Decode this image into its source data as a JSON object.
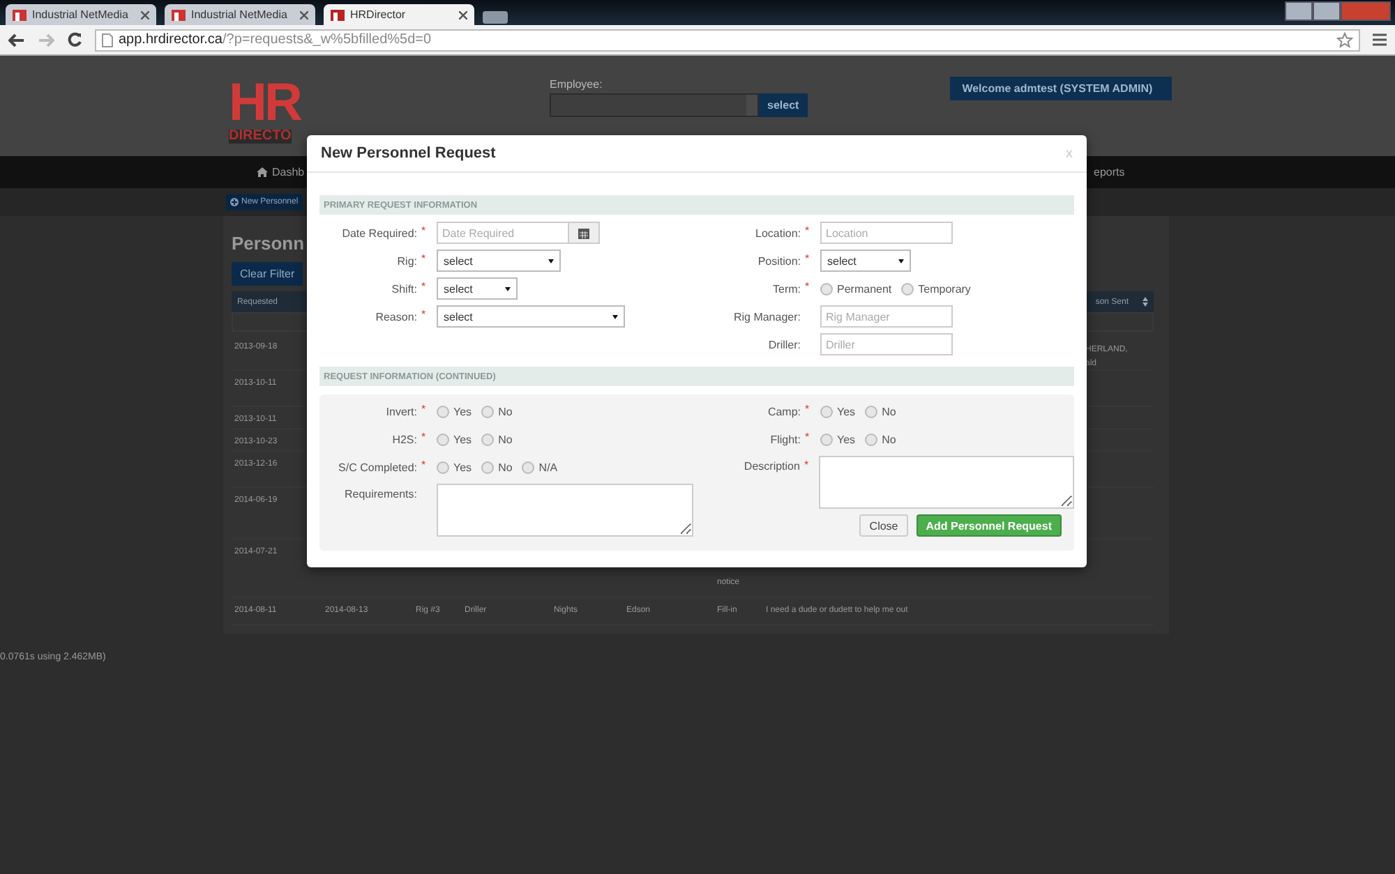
{
  "browser": {
    "tabs": [
      {
        "title": "Industrial NetMedia",
        "selected": false
      },
      {
        "title": "Industrial NetMedia",
        "selected": false
      },
      {
        "title": "HRDirector",
        "selected": true
      }
    ],
    "url_host": "app.hrdirector.ca",
    "url_path": "/?p=requests&_w%5bfilled%5d=0"
  },
  "header": {
    "logo_letters": "HR",
    "logo_word": "DIRECTO",
    "employee_label": "Employee:",
    "select_button": "select",
    "welcome": "Welcome admtest (SYSTEM ADMIN)"
  },
  "nav": {
    "items": [
      "Dashb",
      "eports"
    ]
  },
  "subbar": {
    "new_button": "New Personnel"
  },
  "page": {
    "title": "Personn",
    "clear_filter": "Clear Filter",
    "table": {
      "columns": [
        "Requested",
        "son Sent"
      ],
      "rows": [
        {
          "cells": [
            "2013-09-18"
          ],
          "right": [
            "HERLAND,",
            "ald"
          ]
        },
        {
          "cells": [
            "2013-10-11"
          ]
        },
        {
          "cells": [
            "2013-10-11"
          ]
        },
        {
          "cells": [
            "2013-10-23"
          ]
        },
        {
          "cells": [
            "2013-12-16"
          ]
        },
        {
          "cells": [
            "2014-06-19"
          ]
        },
        {
          "cells": [
            "2014-07-21"
          ],
          "note": "notice"
        },
        {
          "cells": [
            "2014-08-11",
            "2014-08-13",
            "Rig #3",
            "Driller",
            "Nights",
            "Edson",
            "Fill-in",
            "I need a dude or dudett to help me out"
          ]
        }
      ]
    }
  },
  "footer": "0.0761s using 2.462MB)",
  "modal": {
    "title": "New Personnel Request",
    "close": "x",
    "required_mark": "*",
    "sections": [
      {
        "heading": "PRIMARY REQUEST INFORMATION",
        "shaded": false,
        "columns": [
          [
            {
              "label": "Date Required:",
              "required": true,
              "kind": "date",
              "placeholder": "Date Required"
            },
            {
              "label": "Rig:",
              "required": true,
              "kind": "select",
              "value": "select"
            },
            {
              "label": "Shift:",
              "required": true,
              "kind": "select",
              "value": "select"
            },
            {
              "label": "Reason:",
              "required": true,
              "kind": "select",
              "value": "select"
            }
          ],
          [
            {
              "label": "Location:",
              "required": true,
              "kind": "text",
              "placeholder": "Location"
            },
            {
              "label": "Position:",
              "required": true,
              "kind": "select",
              "value": "select"
            },
            {
              "label": "Term:",
              "required": true,
              "kind": "radio",
              "options": [
                {
                  "label": "Permanent",
                  "selected": false
                },
                {
                  "label": "Temporary",
                  "selected": false
                }
              ]
            },
            {
              "label": "Rig Manager:",
              "required": false,
              "kind": "text",
              "placeholder": "Rig Manager"
            },
            {
              "label": "Driller:",
              "required": false,
              "kind": "text",
              "placeholder": "Driller"
            }
          ]
        ]
      },
      {
        "heading": "REQUEST INFORMATION (CONTINUED)",
        "shaded": true,
        "columns": [
          [
            {
              "label": "Invert:",
              "required": true,
              "kind": "radio",
              "options": [
                {
                  "label": "Yes",
                  "selected": false
                },
                {
                  "label": "No",
                  "selected": false
                }
              ]
            },
            {
              "label": "H2S:",
              "required": true,
              "kind": "radio",
              "options": [
                {
                  "label": "Yes",
                  "selected": false
                },
                {
                  "label": "No",
                  "selected": false
                }
              ]
            },
            {
              "label": "S/C Completed:",
              "required": true,
              "kind": "radio",
              "options": [
                {
                  "label": "Yes",
                  "selected": false
                },
                {
                  "label": "No",
                  "selected": false
                },
                {
                  "label": "N/A",
                  "selected": false
                }
              ]
            },
            {
              "label": "Requirements:",
              "required": false,
              "kind": "textarea"
            }
          ],
          [
            {
              "label": "Camp:",
              "required": true,
              "kind": "radio",
              "options": [
                {
                  "label": "Yes",
                  "selected": false
                },
                {
                  "label": "No",
                  "selected": false
                }
              ]
            },
            {
              "label": "Flight:",
              "required": true,
              "kind": "radio",
              "options": [
                {
                  "label": "Yes",
                  "selected": false
                },
                {
                  "label": "No",
                  "selected": false
                }
              ]
            },
            {
              "label": "Description",
              "required": true,
              "kind": "textarea"
            }
          ]
        ]
      }
    ],
    "buttons": [
      {
        "label": "Close",
        "kind": "default"
      },
      {
        "label": "Add Personnel Request",
        "kind": "primary"
      }
    ]
  }
}
